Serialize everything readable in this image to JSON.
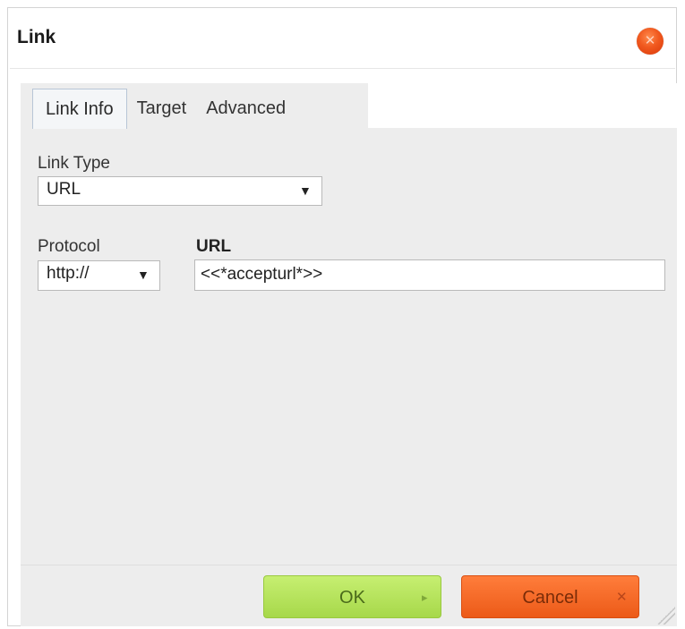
{
  "dialog": {
    "title": "Link",
    "close_icon": "close-icon"
  },
  "tabs": [
    {
      "label": "Link Info",
      "active": true
    },
    {
      "label": "Target",
      "active": false
    },
    {
      "label": "Advanced",
      "active": false
    }
  ],
  "link_info": {
    "link_type_label": "Link Type",
    "link_type_value": "URL",
    "protocol_label": "Protocol",
    "protocol_value": "http://",
    "url_label": "URL",
    "url_value": "<<*accepturl*>>",
    "dropdown_arrow": "▼"
  },
  "buttons": {
    "ok_label": "OK",
    "ok_icon": "▸",
    "cancel_label": "Cancel",
    "cancel_icon": "✕"
  },
  "colors": {
    "close": "#f0581e",
    "ok": "#b4e15c",
    "cancel": "#f2601f",
    "panel": "#ededed"
  }
}
